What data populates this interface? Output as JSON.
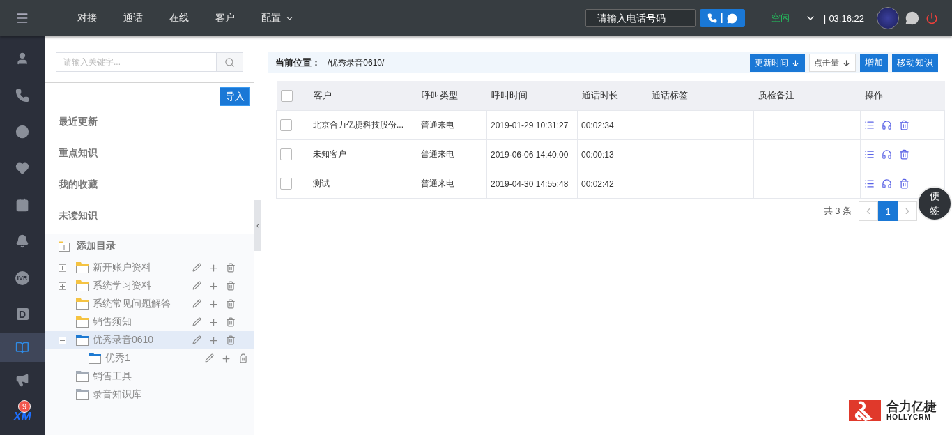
{
  "topbar": {
    "tabs": [
      {
        "label": "对接",
        "dropdown": false
      },
      {
        "label": "通话",
        "dropdown": false
      },
      {
        "label": "在线",
        "dropdown": false
      },
      {
        "label": "客户",
        "dropdown": false
      },
      {
        "label": "配置",
        "dropdown": true
      }
    ],
    "phone_field": {
      "placeholder": "请输入电话号码"
    },
    "status": "空闲",
    "separator": "|",
    "clock": "03:16:22"
  },
  "rail": {
    "items": [
      {
        "kind": "user",
        "selected": false
      },
      {
        "kind": "phone",
        "selected": false
      },
      {
        "kind": "chat",
        "selected": false
      },
      {
        "kind": "contacts",
        "selected": false
      },
      {
        "kind": "calendar",
        "selected": false
      },
      {
        "kind": "bell",
        "selected": false
      },
      {
        "kind": "ivr",
        "label": "IVR",
        "selected": false
      },
      {
        "kind": "letter",
        "label": "D",
        "selected": false
      },
      {
        "kind": "book",
        "selected": true
      },
      {
        "kind": "megaphone",
        "selected": false
      },
      {
        "kind": "xm",
        "label": "XM",
        "badge": "9",
        "selected": false
      }
    ]
  },
  "panel": {
    "search": {
      "placeholder": "请输入关键字..."
    },
    "import_button": "导入",
    "nav": [
      "最近更新",
      "重点知识",
      "我的收藏",
      "未读知识"
    ],
    "add_dir": "添加目录",
    "tree": [
      {
        "label": "新开账户资料",
        "color": "#f5c342",
        "expanded": false,
        "selected": false,
        "actions": true
      },
      {
        "label": "系统学习资料",
        "color": "#f5c342",
        "expanded": false,
        "selected": false,
        "actions": true
      },
      {
        "label": "系统常见问题解答",
        "color": "#f5c342",
        "selected": false,
        "actions": true
      },
      {
        "label": "销售须知",
        "color": "#f5c342",
        "selected": false,
        "actions": true
      },
      {
        "label": "优秀录音0610",
        "color": "#1e7ad2",
        "expanded": true,
        "selected": true,
        "actions": true,
        "children": [
          {
            "label": "优秀1",
            "color": "#1e7ad2",
            "selected": false,
            "actions": true
          }
        ]
      },
      {
        "label": "销售工具",
        "color": "#a3abb6",
        "selected": false,
        "actions": false
      },
      {
        "label": "录音知识库",
        "color": "#a3abb6",
        "selected": false,
        "actions": false
      }
    ]
  },
  "main": {
    "location_label": "当前位置：",
    "location_path": "/优秀录音0610/",
    "sort_buttons": [
      {
        "label": "更新时间",
        "selected": true
      },
      {
        "label": "点击量",
        "selected": false
      }
    ],
    "action_buttons": [
      "增加",
      "移动知识"
    ],
    "table": {
      "header_checked": false,
      "columns": [
        "客户",
        "呼叫类型",
        "呼叫时间",
        "通话时长",
        "通话标签",
        "质检备注",
        "操作"
      ],
      "rows": [
        {
          "checked": false,
          "cells": [
            "北京合力亿捷科技股份...",
            "普通来电",
            "2019-01-29 10:31:27",
            "00:02:34"
          ]
        },
        {
          "checked": false,
          "cells": [
            "未知客户",
            "普通来电",
            "2019-06-06 14:40:00",
            "00:00:13"
          ]
        },
        {
          "checked": false,
          "cells": [
            "测试",
            "普通来电",
            "2019-04-30 14:55:48",
            "00:02:42"
          ]
        }
      ]
    },
    "total": "共 3 条",
    "pages": [
      {
        "label": "1",
        "selected": true
      }
    ],
    "note_button": "便签",
    "logo": {
      "name": "合力亿捷",
      "sub": "HOLLYCRM"
    }
  }
}
